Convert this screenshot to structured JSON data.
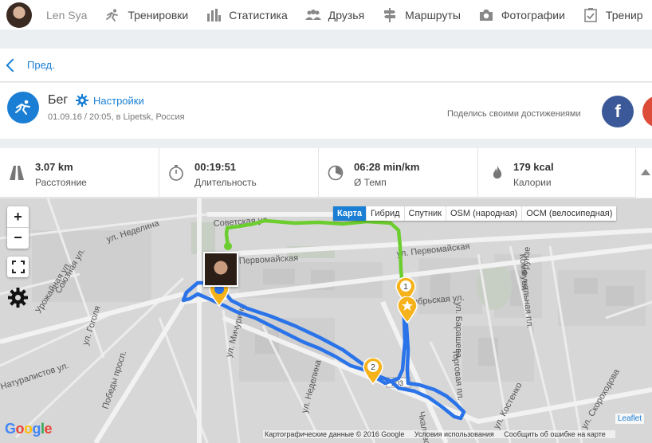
{
  "nav": {
    "username": "Len Sya",
    "items": [
      {
        "label": "Тренировки",
        "icon": "running-icon"
      },
      {
        "label": "Статистика",
        "icon": "bar-chart-icon"
      },
      {
        "label": "Друзья",
        "icon": "friends-icon"
      },
      {
        "label": "Маршруты",
        "icon": "signpost-icon"
      },
      {
        "label": "Фотографии",
        "icon": "camera-icon"
      },
      {
        "label": "Тренир",
        "icon": "checklist-icon"
      }
    ]
  },
  "back": {
    "label": "Пред."
  },
  "activity": {
    "title": "Бег",
    "settings_label": "Настройки",
    "subtitle": "01.09.16 / 20:05, в Lipetsk, Россия",
    "share_label": "Поделись своими достижениями",
    "facebook_letter": "f"
  },
  "stats": [
    {
      "value": "3.07 km",
      "label": "Расстояние",
      "icon": "road-icon"
    },
    {
      "value": "00:19:51",
      "label": "Длительность",
      "icon": "stopwatch-icon"
    },
    {
      "value": "06:28 min/km",
      "label": "Ø Темп",
      "icon": "pace-icon"
    },
    {
      "value": "179 kcal",
      "label": "Калории",
      "icon": "flame-icon"
    }
  ],
  "map": {
    "zoom_in": "+",
    "zoom_out": "−",
    "layers": [
      "Карта",
      "Гибрид",
      "Спутник",
      "OSM (народная)",
      "OCM (велосипедная)"
    ],
    "active_layer": "Карта",
    "streets": [
      "ул. Неделина",
      "Советская ул.",
      "Первомайская",
      "ул. Первомайская",
      "Октябрьская ул.",
      "ул. Барашева",
      "Коммунальная пл.",
      "ул. Фрунзе",
      "Союзная ул.",
      "Урожайная ул.",
      "ул. Гоголя",
      "Победы просп.",
      "ул. Мичурина",
      "ул. Неделина",
      "Торговая пл.",
      "ул. Костенко",
      "ул. Скороходова",
      "Чкаловская",
      "Натуралистов ул."
    ],
    "markers": [
      "1",
      "2"
    ],
    "road_number": "203",
    "attribution": [
      "Картографические данные © 2016 Google",
      "Условия использования",
      "Сообщить об ошибке на карте"
    ],
    "leaflet": "Leaflet",
    "google_logo": "Google"
  },
  "colors": {
    "accent": "#1a7fd4",
    "route_blue": "#2a73e8",
    "route_green": "#6ccd2e",
    "marker": "#f5b21b"
  }
}
